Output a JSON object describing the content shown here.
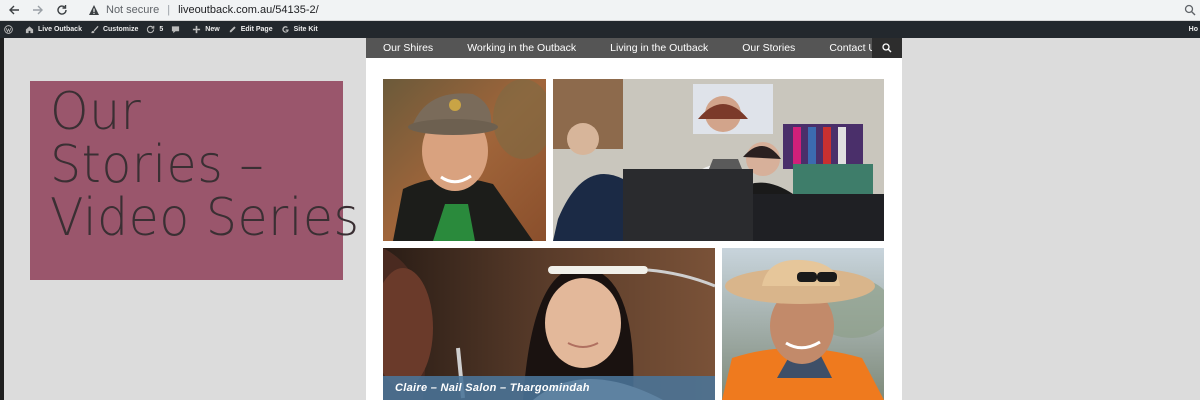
{
  "browser": {
    "security_label": "Not secure",
    "url": "liveoutback.com.au/54135-2/",
    "icons": [
      "back-arrow-icon",
      "forward-arrow-icon",
      "reload-icon",
      "warning-icon",
      "search-icon"
    ]
  },
  "admin_bar": {
    "items": [
      {
        "label": "Live Outback",
        "icon": "home-icon"
      },
      {
        "label": "Customize",
        "icon": "brush-icon"
      },
      {
        "label": "5",
        "icon": "updates-icon"
      },
      {
        "label": "",
        "icon": "comment-icon"
      },
      {
        "label": "New",
        "icon": "plus-icon"
      },
      {
        "label": "Edit Page",
        "icon": "pencil-icon"
      },
      {
        "label": "Site Kit",
        "icon": "google-g-icon"
      }
    ],
    "right_label": "Ho"
  },
  "hero": {
    "lines": [
      "Our",
      "Stories –",
      "Video Series"
    ]
  },
  "site_nav": {
    "items": [
      "Our Shires",
      "Working in the Outback",
      "Living in the Outback",
      "Our Stories",
      "Contact Us"
    ]
  },
  "gallery": {
    "caption": "Claire – Nail Salon – Thargomindah"
  },
  "colors": {
    "hero_bg": "#9a566c",
    "hero_text": "#3a2f33",
    "nav_bg": "#555555",
    "caption_bg": "#4a7498",
    "admin_bar_bg": "#23282d",
    "page_bg": "#dcdcdc"
  }
}
